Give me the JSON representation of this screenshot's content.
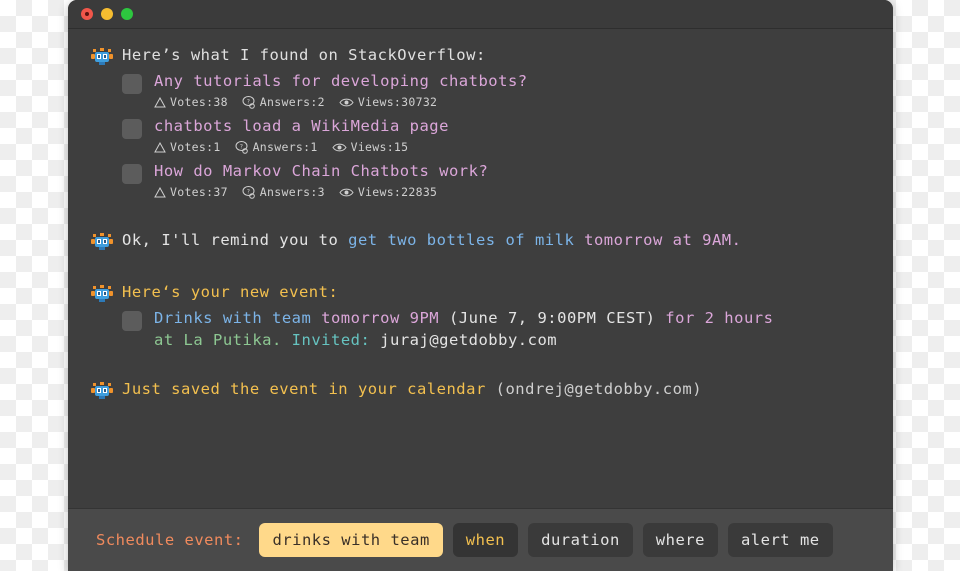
{
  "window": {
    "controls": [
      {
        "name": "close",
        "color": "#f1564a"
      },
      {
        "name": "minimize",
        "color": "#f6bd30"
      },
      {
        "name": "maximize",
        "color": "#2dc73f"
      }
    ]
  },
  "chat": {
    "message_stackoverflow_intro": "Here’s what I found on StackOverflow:",
    "stackoverflow_results": [
      {
        "title": "Any tutorials for developing chatbots?",
        "votes_label": "Votes:38",
        "answers_label": "Answers:2",
        "views_label": "Views:30732"
      },
      {
        "title": "chatbots load a WikiMedia page",
        "votes_label": "Votes:1",
        "answers_label": "Answers:1",
        "views_label": "Views:15"
      },
      {
        "title": "How do Markov Chain Chatbots work?",
        "votes_label": "Votes:37",
        "answers_label": "Answers:3",
        "views_label": "Views:22835"
      }
    ],
    "reminder_message": {
      "prefix": "Ok, I'll remind you to ",
      "task": "get two bottles of milk",
      "sep": " ",
      "time": "tomorrow at 9AM."
    },
    "event_intro": "Here‘s your new event:",
    "event": {
      "title": "Drinks with team",
      "when": " tomorrow 9PM",
      "resolved_date": " (June 7, 9:00PM CEST)",
      "duration": " for 2 hours",
      "location": "at La Putika.",
      "invited_label": " Invited:",
      "invitee": " juraj@getdobby.com"
    },
    "saved_message": {
      "text": "Just saved the event in your calendar",
      "account": " (ondrej@getdobby.com)"
    }
  },
  "bottombar": {
    "label": "Schedule event:",
    "chips": [
      {
        "label": "drinks with team",
        "state": "selected"
      },
      {
        "label": "when",
        "state": "filled"
      },
      {
        "label": "duration",
        "state": "empty"
      },
      {
        "label": "where",
        "state": "empty"
      },
      {
        "label": "alert me",
        "state": "empty"
      }
    ]
  },
  "colors": {
    "window_bg": "#3e3e3e",
    "titlebar_bg": "#3b3b3b",
    "bottombar_bg": "#4a4a4a",
    "accent_pink": "#dba6d9",
    "accent_blue": "#7cb4e8",
    "accent_amber": "#f3c04f",
    "accent_green": "#8dc792",
    "accent_teal": "#66c3c0",
    "accent_salmon": "#f08a5d",
    "chip_selected_bg": "#ffd98a"
  }
}
